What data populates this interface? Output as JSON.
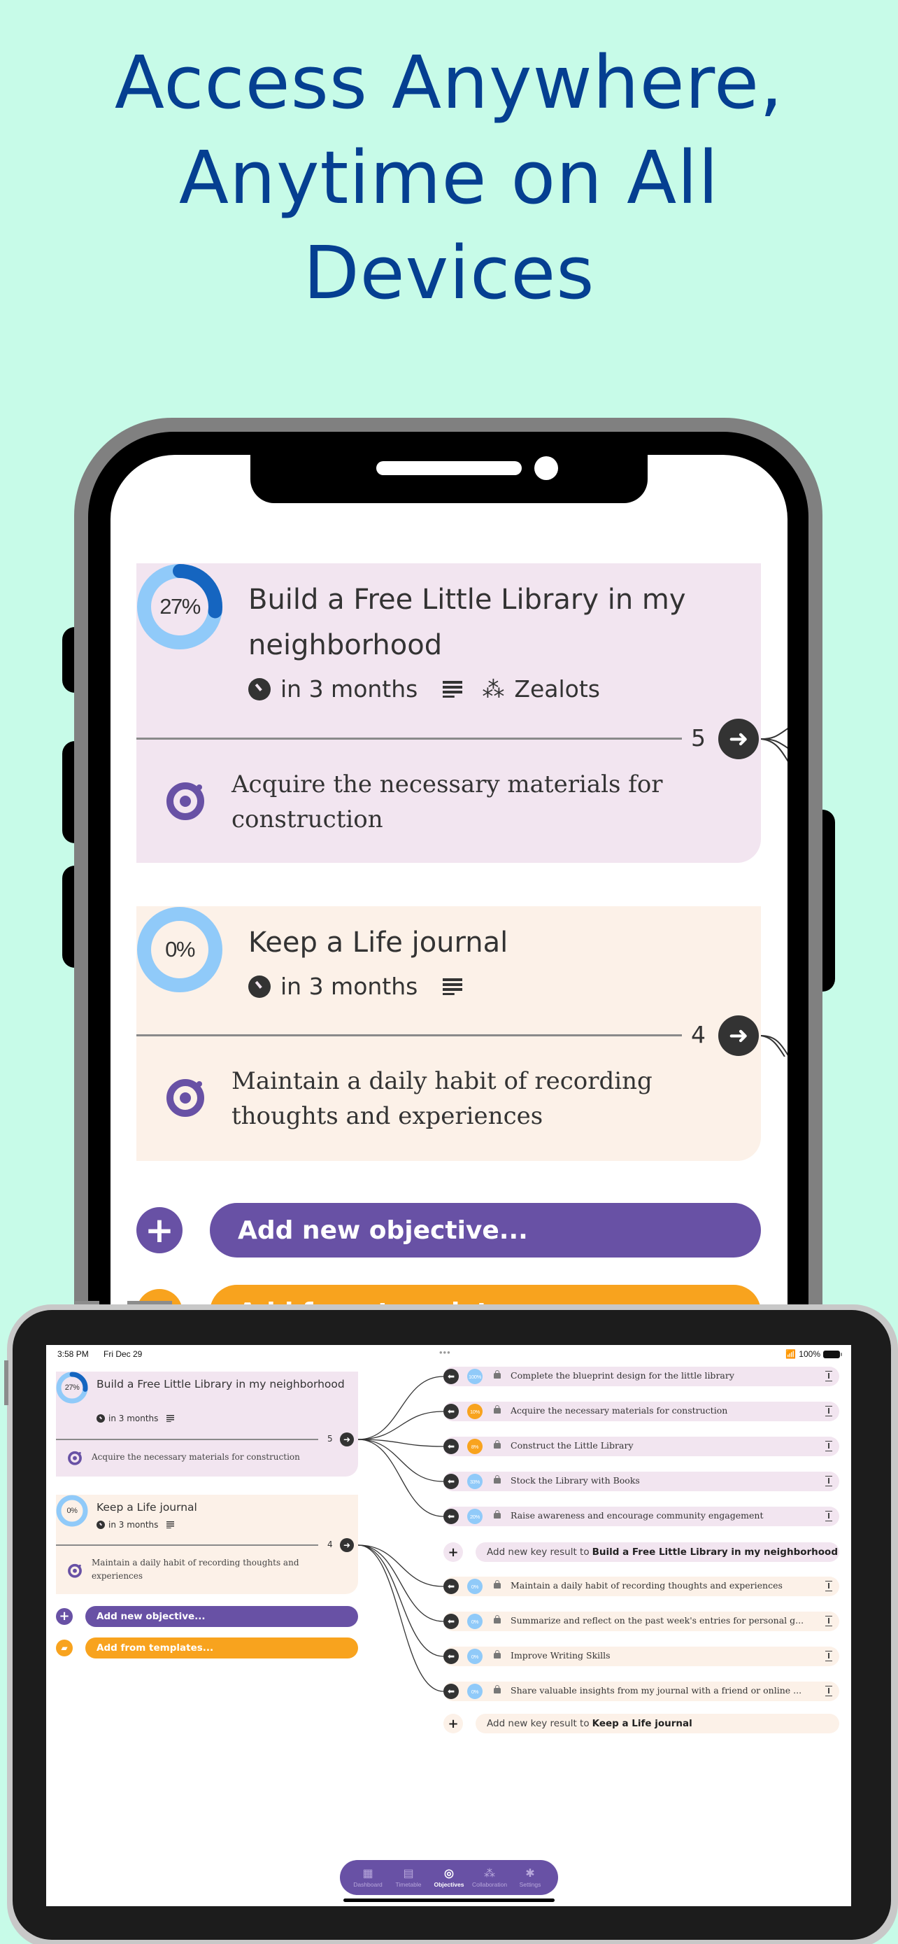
{
  "headline": {
    "line1": "Access Anywhere,",
    "line2": "Anytime on All",
    "line3": "Devices"
  },
  "colors": {
    "background": "#c7fbe8",
    "headline": "#053f91",
    "purple": "#6851a5",
    "orange": "#f8a31e",
    "ring_light": "#90caf9",
    "ring_dark": "#1565c0",
    "card_library": "#f2e5f0",
    "card_journal": "#fcf1e8"
  },
  "objectives": [
    {
      "title": "Build a Free Little Library in my neighborhood",
      "progress_percent": 27,
      "progress_label": "27%",
      "due": "in 3 months",
      "team": "Zealots",
      "key_result_count": "5",
      "highlight_key_result": "Acquire the necessary materials for construction"
    },
    {
      "title": "Keep a Life journal",
      "progress_percent": 0,
      "progress_label": "0%",
      "due": "in 3 months",
      "key_result_count": "4",
      "highlight_key_result": "Maintain a daily habit of recording thoughts and experiences"
    }
  ],
  "actions": {
    "add_objective": "Add new objective...",
    "add_from_templates": "Add from templates..."
  },
  "tablet": {
    "status": {
      "time": "3:58 PM",
      "date": "Fri Dec 29",
      "dots": "•••",
      "battery": "100%"
    },
    "key_results": {
      "library": [
        {
          "label": "Complete the blueprint design for the little library",
          "progress": "100%",
          "progress_value": 100,
          "color": "#90caf9"
        },
        {
          "label": "Acquire the necessary materials for construction",
          "progress": "10%",
          "progress_value": 10,
          "color": "#f8a31e"
        },
        {
          "label": "Construct the Little Library",
          "progress": "8%",
          "progress_value": 8,
          "color": "#f8a31e"
        },
        {
          "label": "Stock the Library with Books",
          "progress": "33%",
          "progress_value": 33,
          "color": "#90caf9"
        },
        {
          "label": "Raise awareness and encourage community engagement",
          "progress": "20%",
          "progress_value": 20,
          "color": "#90caf9"
        }
      ],
      "journal": [
        {
          "label": "Maintain a daily habit of recording thoughts and experiences",
          "progress": "0%",
          "progress_value": 0,
          "color": "#90caf9"
        },
        {
          "label": "Summarize and reflect on the past week's entries for personal g...",
          "progress": "0%",
          "progress_value": 0,
          "color": "#90caf9"
        },
        {
          "label": "Improve Writing Skills",
          "progress": "0%",
          "progress_value": 0,
          "color": "#90caf9"
        },
        {
          "label": "Share valuable insights from my journal with a friend or online ...",
          "progress": "0%",
          "progress_value": 0,
          "color": "#90caf9"
        }
      ]
    },
    "add_key_result_prefix": "Add new key result to",
    "add_key_result_library": "Build a Free Little Library in my neighborhood",
    "add_key_result_journal": "Keep a Life journal",
    "tabbar": [
      {
        "label": "Dashboard",
        "icon": "dashboard-icon",
        "glyph": "▦",
        "active": false
      },
      {
        "label": "Timetable",
        "icon": "calendar-icon",
        "glyph": "▤",
        "active": false
      },
      {
        "label": "Objectives",
        "icon": "target-icon",
        "glyph": "◎",
        "active": true
      },
      {
        "label": "Collaboration",
        "icon": "collaboration-icon",
        "glyph": "⁂",
        "active": false
      },
      {
        "label": "Settings",
        "icon": "gear-icon",
        "glyph": "✱",
        "active": false
      }
    ]
  }
}
